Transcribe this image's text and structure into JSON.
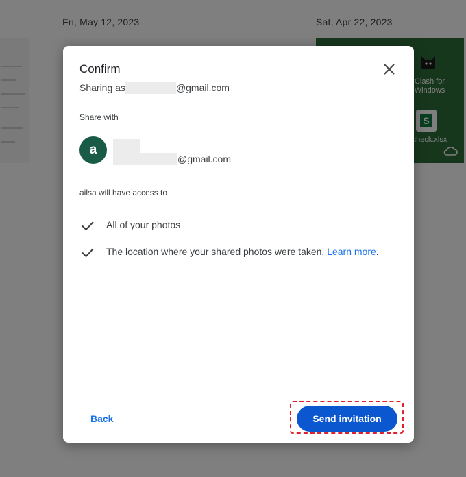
{
  "background": {
    "dates": [
      "Fri, May 12, 2023",
      "Sat, Apr 22, 2023"
    ],
    "desktop_items": [
      {
        "label": "Clash for Windows",
        "icon": "cat-app-icon"
      },
      {
        "label": "check.xlsx",
        "icon": "spreadsheet-icon"
      }
    ]
  },
  "dialog": {
    "title": "Confirm",
    "sharing_as_prefix": "Sharing as",
    "sharing_as_email_suffix": "@gmail.com",
    "share_with_heading": "Share with",
    "recipient": {
      "avatar_letter": "a",
      "avatar_color": "#1a5b47",
      "email_suffix": "@gmail.com"
    },
    "access_heading": "ailsa will have access to",
    "access_items": [
      {
        "text": "All of your photos"
      },
      {
        "text": "The location where your shared photos were taken.",
        "link": "Learn more",
        "trailing": "."
      }
    ],
    "back_label": "Back",
    "send_label": "Send invitation"
  },
  "colors": {
    "primary_button": "#0b57d0",
    "link": "#1a73e8",
    "highlight": "#e0202a"
  }
}
